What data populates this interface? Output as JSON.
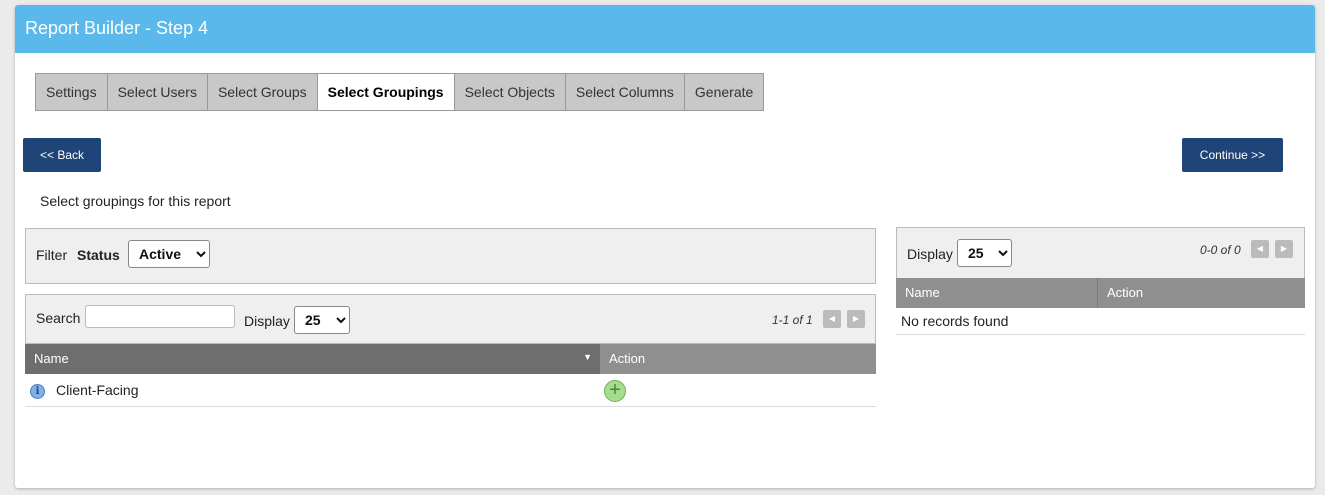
{
  "header": {
    "title": "Report Builder - Step 4"
  },
  "tabs": [
    {
      "label": "Settings",
      "active": false
    },
    {
      "label": "Select Users",
      "active": false
    },
    {
      "label": "Select Groups",
      "active": false
    },
    {
      "label": "Select Groupings",
      "active": true
    },
    {
      "label": "Select Objects",
      "active": false
    },
    {
      "label": "Select Columns",
      "active": false
    },
    {
      "label": "Generate",
      "active": false
    }
  ],
  "buttons": {
    "back": "<< Back",
    "continue": "Continue >>"
  },
  "instruction": "Select groupings for this report",
  "filter": {
    "label": "Filter",
    "status_label": "Status",
    "status_value": "Active"
  },
  "left_grid": {
    "search_label": "Search",
    "search_value": "",
    "display_label": "Display",
    "display_value": "25",
    "pager": "1-1 of 1",
    "columns": {
      "name": "Name",
      "action": "Action"
    },
    "sort_indicator": "▼",
    "rows": [
      {
        "name": "Client-Facing",
        "icon": "info-icon",
        "action_icon": "add-icon"
      }
    ]
  },
  "right_grid": {
    "display_label": "Display",
    "display_value": "25",
    "pager": "0-0 of 0",
    "columns": {
      "name": "Name",
      "action": "Action"
    },
    "empty_text": "No records found"
  },
  "colors": {
    "header_bg": "#5ab9ea",
    "button_bg": "#1f4477",
    "sorted_column": "#6e6e6e",
    "column_header": "#8f8f8f"
  }
}
